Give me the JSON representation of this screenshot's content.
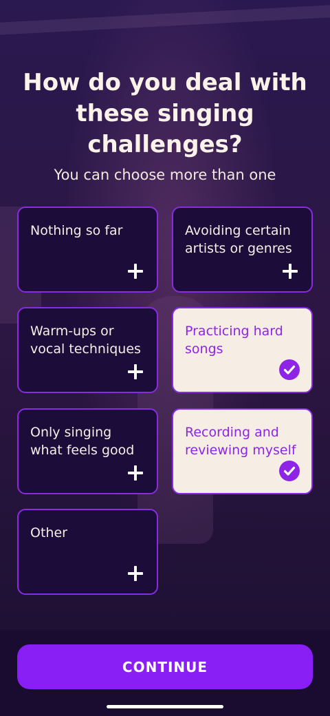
{
  "header": {
    "title": "How do you deal with these singing challenges?",
    "subtitle": "You can choose more than one"
  },
  "options": [
    {
      "label": "Nothing so far",
      "selected": false,
      "icon": "plus-icon"
    },
    {
      "label": "Avoiding certain artists or genres",
      "selected": false,
      "icon": "plus-icon"
    },
    {
      "label": "Warm-ups or vocal techniques",
      "selected": false,
      "icon": "plus-icon"
    },
    {
      "label": "Practicing hard songs",
      "selected": true,
      "icon": "checkmark-icon"
    },
    {
      "label": "Only singing what feels good",
      "selected": false,
      "icon": "plus-icon"
    },
    {
      "label": "Recording and reviewing myself",
      "selected": true,
      "icon": "checkmark-icon"
    },
    {
      "label": "Other",
      "selected": false,
      "icon": "plus-icon"
    }
  ],
  "footer": {
    "continue_label": "CONTINUE"
  },
  "colors": {
    "accent": "#8a1ff5",
    "card_border": "#8a2be2",
    "card_bg": "#1c0c3a",
    "selected_bg": "#f6eee4",
    "selected_text": "#8e24e6"
  }
}
